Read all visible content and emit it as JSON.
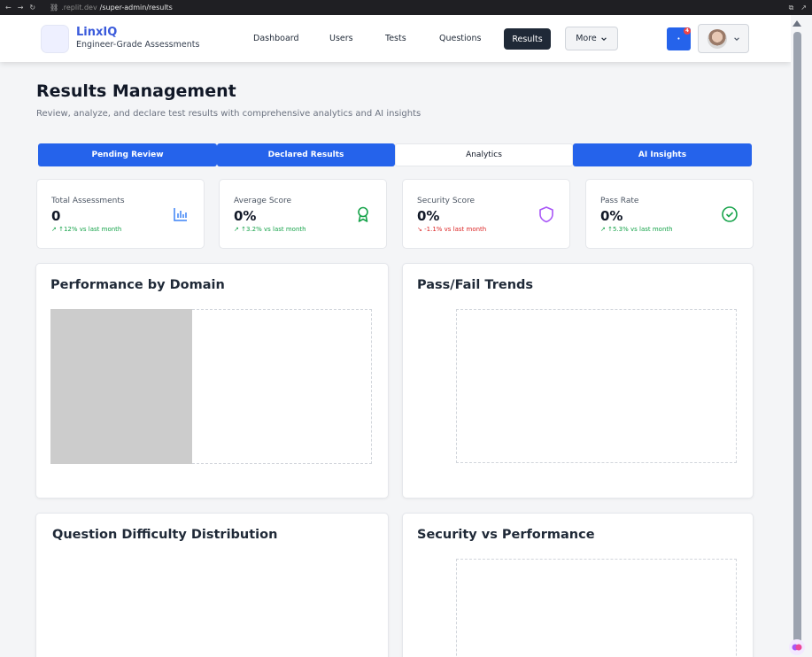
{
  "browser": {
    "url_host": ".replit.dev",
    "url_path": "/super-admin/results"
  },
  "brand": {
    "name": "LinxIQ",
    "tagline": "Engineer-Grade Assessments"
  },
  "nav": {
    "items": [
      "Dashboard",
      "Users",
      "Tests",
      "Questions",
      "Results"
    ],
    "active": "Results",
    "more_label": "More",
    "notification_count": "4"
  },
  "page": {
    "title": "Results Management",
    "subtitle": "Review, analyze, and declare test results with comprehensive analytics and AI insights"
  },
  "tabs": [
    {
      "label": "Pending Review",
      "active": false
    },
    {
      "label": "Declared Results",
      "active": false
    },
    {
      "label": "Analytics",
      "active": true
    },
    {
      "label": "AI Insights",
      "active": false
    }
  ],
  "stats": [
    {
      "label": "Total Assessments",
      "value": "0",
      "change": "↑12% vs last month",
      "trend": "up",
      "icon": "bar-chart-icon",
      "color": "#3b82f6"
    },
    {
      "label": "Average Score",
      "value": "0%",
      "change": "↑3.2% vs last month",
      "trend": "up",
      "icon": "award-icon",
      "color": "#16a34a"
    },
    {
      "label": "Security Score",
      "value": "0%",
      "change": "-1.1% vs last month",
      "trend": "down",
      "icon": "shield-icon",
      "color": "#a855f7"
    },
    {
      "label": "Pass Rate",
      "value": "0%",
      "change": "↑5.3% vs last month",
      "trend": "up",
      "icon": "check-circle-icon",
      "color": "#16a34a"
    }
  ],
  "panels": {
    "domain": {
      "title": "Performance by Domain"
    },
    "trends": {
      "title": "Pass/Fail Trends"
    },
    "difficulty": {
      "title": "Question Difficulty Distribution"
    },
    "security": {
      "title": "Security vs Performance"
    }
  }
}
